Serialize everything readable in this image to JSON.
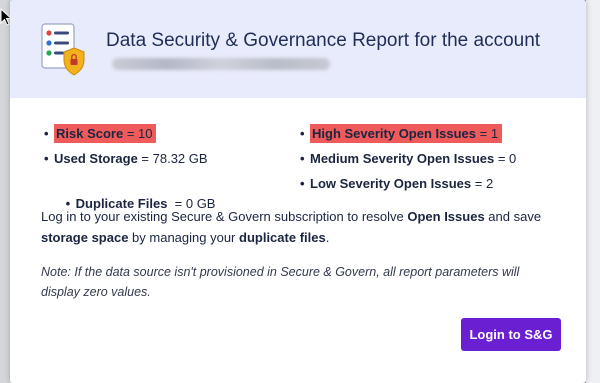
{
  "header": {
    "title": "Data Security & Governance Report for the account",
    "account_name_hidden": true
  },
  "stats": {
    "risk_score": {
      "label": "Risk Score",
      "value": " = 10",
      "highlight": true
    },
    "used_storage": {
      "label": "Used Storage",
      "value": " = 78.32 GB",
      "highlight": false
    },
    "duplicate_files": {
      "label": "Duplicate Files",
      "value": "  = 0 GB",
      "highlight": false
    },
    "high_severity": {
      "label": "High Severity Open Issues",
      "value": " = 1",
      "highlight": true
    },
    "medium_severity": {
      "label": "Medium Severity Open Issues",
      "value": " = 0",
      "highlight": false
    },
    "low_severity": {
      "label": "Low Severity Open Issues",
      "value": " = 2",
      "highlight": false
    }
  },
  "bullet": "•",
  "message": {
    "p1": "Log in to your existing Secure & Govern subscription to resolve ",
    "b1": "Open Issues",
    "p2": " and save ",
    "b2": "storage space",
    "p3": " by managing your ",
    "b3": "duplicate files",
    "p4": "."
  },
  "note": "Note: If the data source isn't provisioned in Secure & Govern, all report parameters will display zero values.",
  "login_button": "Login to S&G",
  "colors": {
    "header_bg": "#e8ebfb",
    "highlight": "#ef5a5a",
    "button": "#6a1fd0",
    "text": "#1b2540"
  }
}
